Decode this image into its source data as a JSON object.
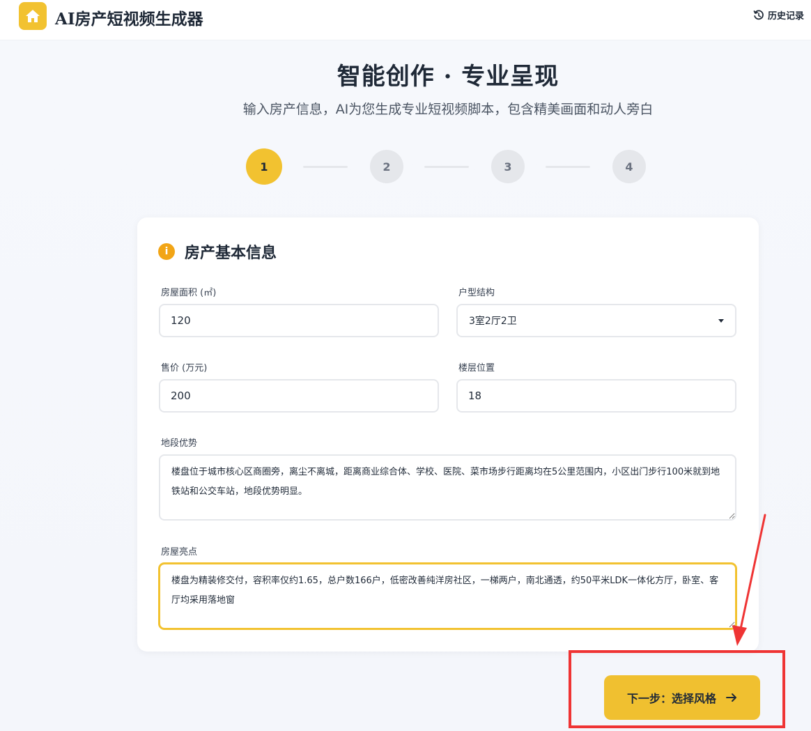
{
  "header": {
    "app_title": "AI房产短视频生成器",
    "history_label": "历史记录",
    "logo_icon": "home-icon",
    "history_icon": "history-icon",
    "brand_color": "#f2c230"
  },
  "hero": {
    "title": "智能创作 · 专业呈现",
    "subtitle": "输入房产信息，AI为您生成专业短视频脚本，包含精美画面和动人旁白"
  },
  "steps": {
    "current": 1,
    "items": [
      "1",
      "2",
      "3",
      "4"
    ]
  },
  "form": {
    "section_title": "房产基本信息",
    "section_icon": "info-icon",
    "area": {
      "label": "房屋面积 (㎡)",
      "value": "120"
    },
    "layout": {
      "label": "户型结构",
      "value": "3室2厅2卫"
    },
    "price": {
      "label": "售价 (万元)",
      "value": "200"
    },
    "floor": {
      "label": "楼层位置",
      "value": "18"
    },
    "location": {
      "label": "地段优势",
      "value": "楼盘位于城市核心区商圈旁，离尘不离城，距离商业综合体、学校、医院、菜市场步行距离均在5公里范围内，小区出门步行100米就到地铁站和公交车站，地段优势明显。"
    },
    "highlights": {
      "label": "房屋亮点",
      "value": "楼盘为精装修交付，容积率仅约1.65，总户数166户，低密改善纯洋房社区，一梯两户，南北通透，约50平米LDK一体化方厅，卧室、客厅均采用落地窗"
    }
  },
  "actions": {
    "next_label": "下一步：选择风格",
    "next_icon": "arrow-right-icon"
  },
  "annotation": {
    "highlight_color": "#ef3434"
  }
}
